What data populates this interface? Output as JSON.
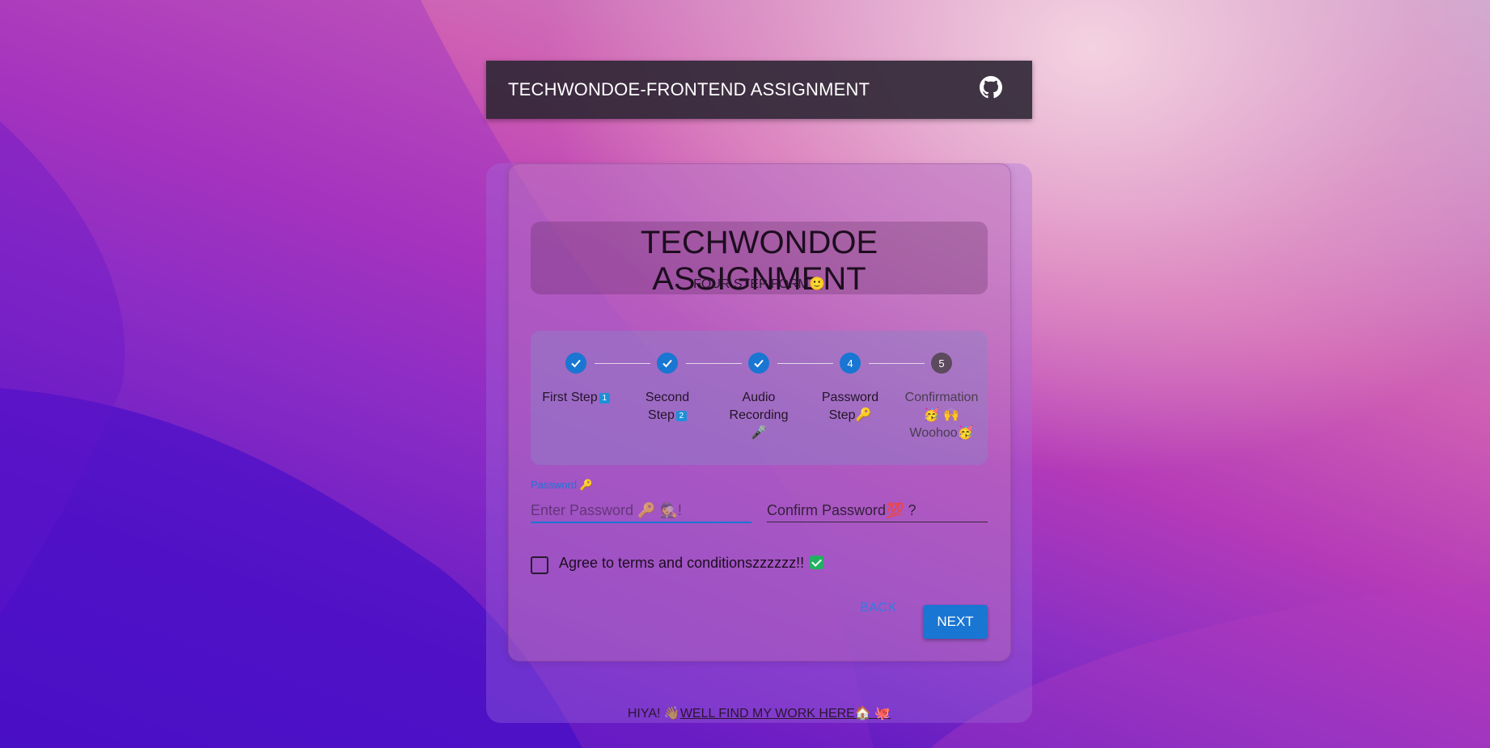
{
  "appbar": {
    "title": "TECHWONDOE-FRONTEND ASSIGNMENT",
    "github_icon": "github-icon"
  },
  "heading": {
    "title": "TECHWONDOE ASSIGNMENT",
    "subtitle": "FOUR STEP FORM🙂"
  },
  "stepper": {
    "steps": [
      {
        "label": "First Step",
        "badge": "1",
        "state": "completed"
      },
      {
        "label": "Second Step",
        "badge": "2",
        "state": "completed"
      },
      {
        "label": "Audio Recording 🎤",
        "state": "completed"
      },
      {
        "label": "Password Step🔑",
        "number": "4",
        "state": "active"
      },
      {
        "label": "Confirmation 🥳 🙌 Woohoo🥳",
        "number": "5",
        "state": "pending"
      }
    ]
  },
  "form": {
    "password_label": "Password 🔑",
    "password_placeholder": "Enter Password 🔑 🕵️!",
    "confirm_placeholder": "Confirm Password💯 ?",
    "terms_label": "Agree to terms and conditionszzzzzz!!",
    "terms_checked": false
  },
  "actions": {
    "back_label": "BACK",
    "next_label": "NEXT"
  },
  "footer": {
    "prefix": "HIYA! 👋🏽",
    "link_text": "WELL FIND MY WORK HERE🏠 🐙"
  },
  "colors": {
    "primary": "#1976d2",
    "appbar": "#2e2634",
    "success": "#21b161"
  }
}
